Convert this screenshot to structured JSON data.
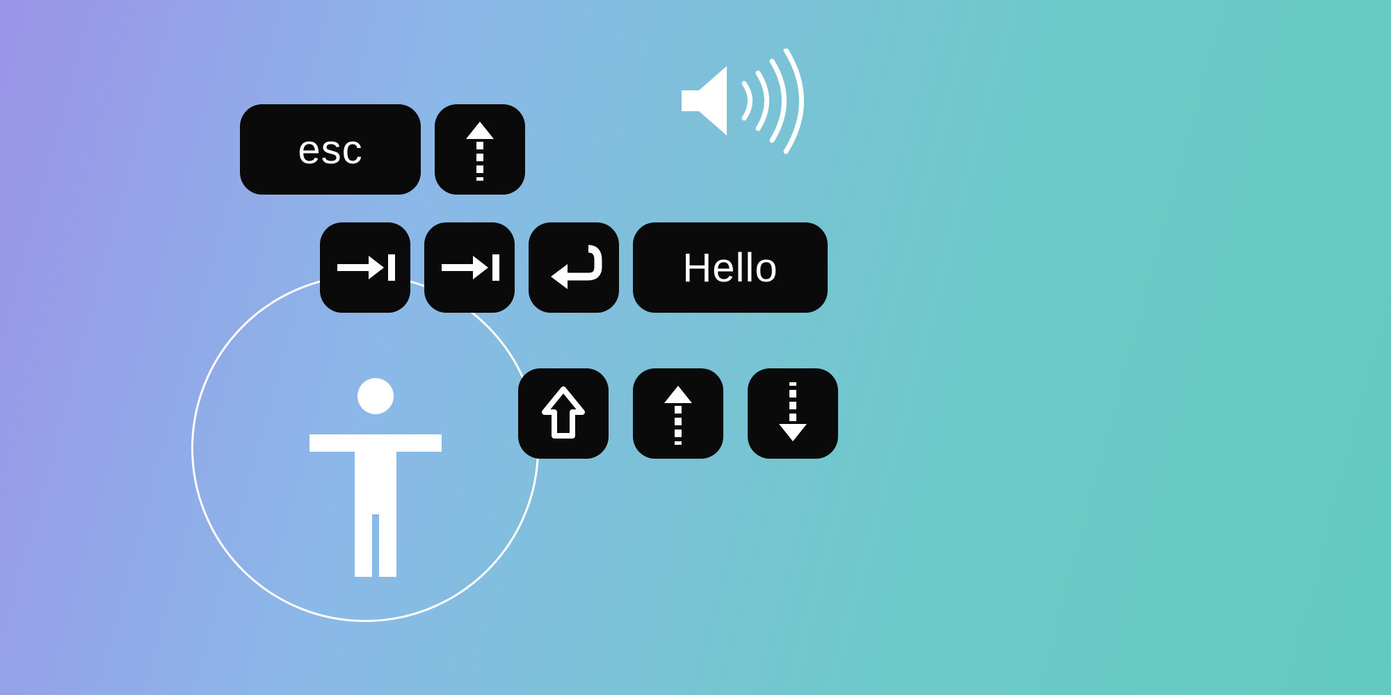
{
  "keys": {
    "esc": "esc",
    "hello": "Hello"
  },
  "icons": {
    "speaker": "speaker-sound-icon",
    "accessibility": "accessibility-figure-icon",
    "arrow_up_dashed": "arrow-up-dashed-icon",
    "tab_right": "tab-arrow-icon",
    "return": "return-enter-icon",
    "shift_up": "shift-up-outline-icon",
    "arrow_up_dashed_2": "arrow-up-dashed-icon",
    "arrow_down_dashed": "arrow-down-dashed-icon"
  }
}
